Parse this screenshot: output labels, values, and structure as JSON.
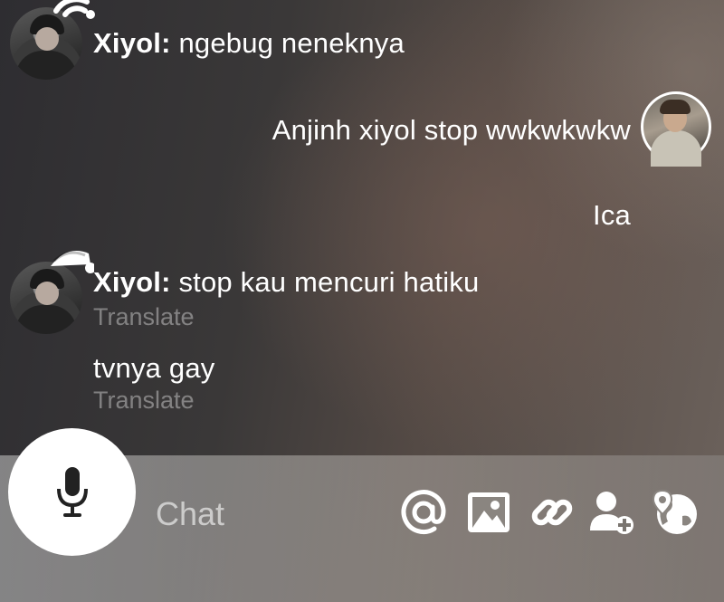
{
  "messages": [
    {
      "sender": "Xiyol:",
      "text": "ngebug neneknya"
    },
    {
      "text": "Anjinh xiyol stop wwkwkwkw"
    },
    {
      "text": "Ica"
    },
    {
      "sender": "Xiyol:",
      "text": "stop kau mencuri hatiku",
      "translate": "Translate"
    },
    {
      "text": "tvnya gay",
      "translate": "Translate"
    }
  ],
  "input": {
    "placeholder": "Chat"
  },
  "toolbar": {
    "icons": [
      "mic-icon",
      "at-mention-icon",
      "image-icon",
      "link-icon",
      "add-user-icon",
      "globe-location-icon"
    ]
  }
}
